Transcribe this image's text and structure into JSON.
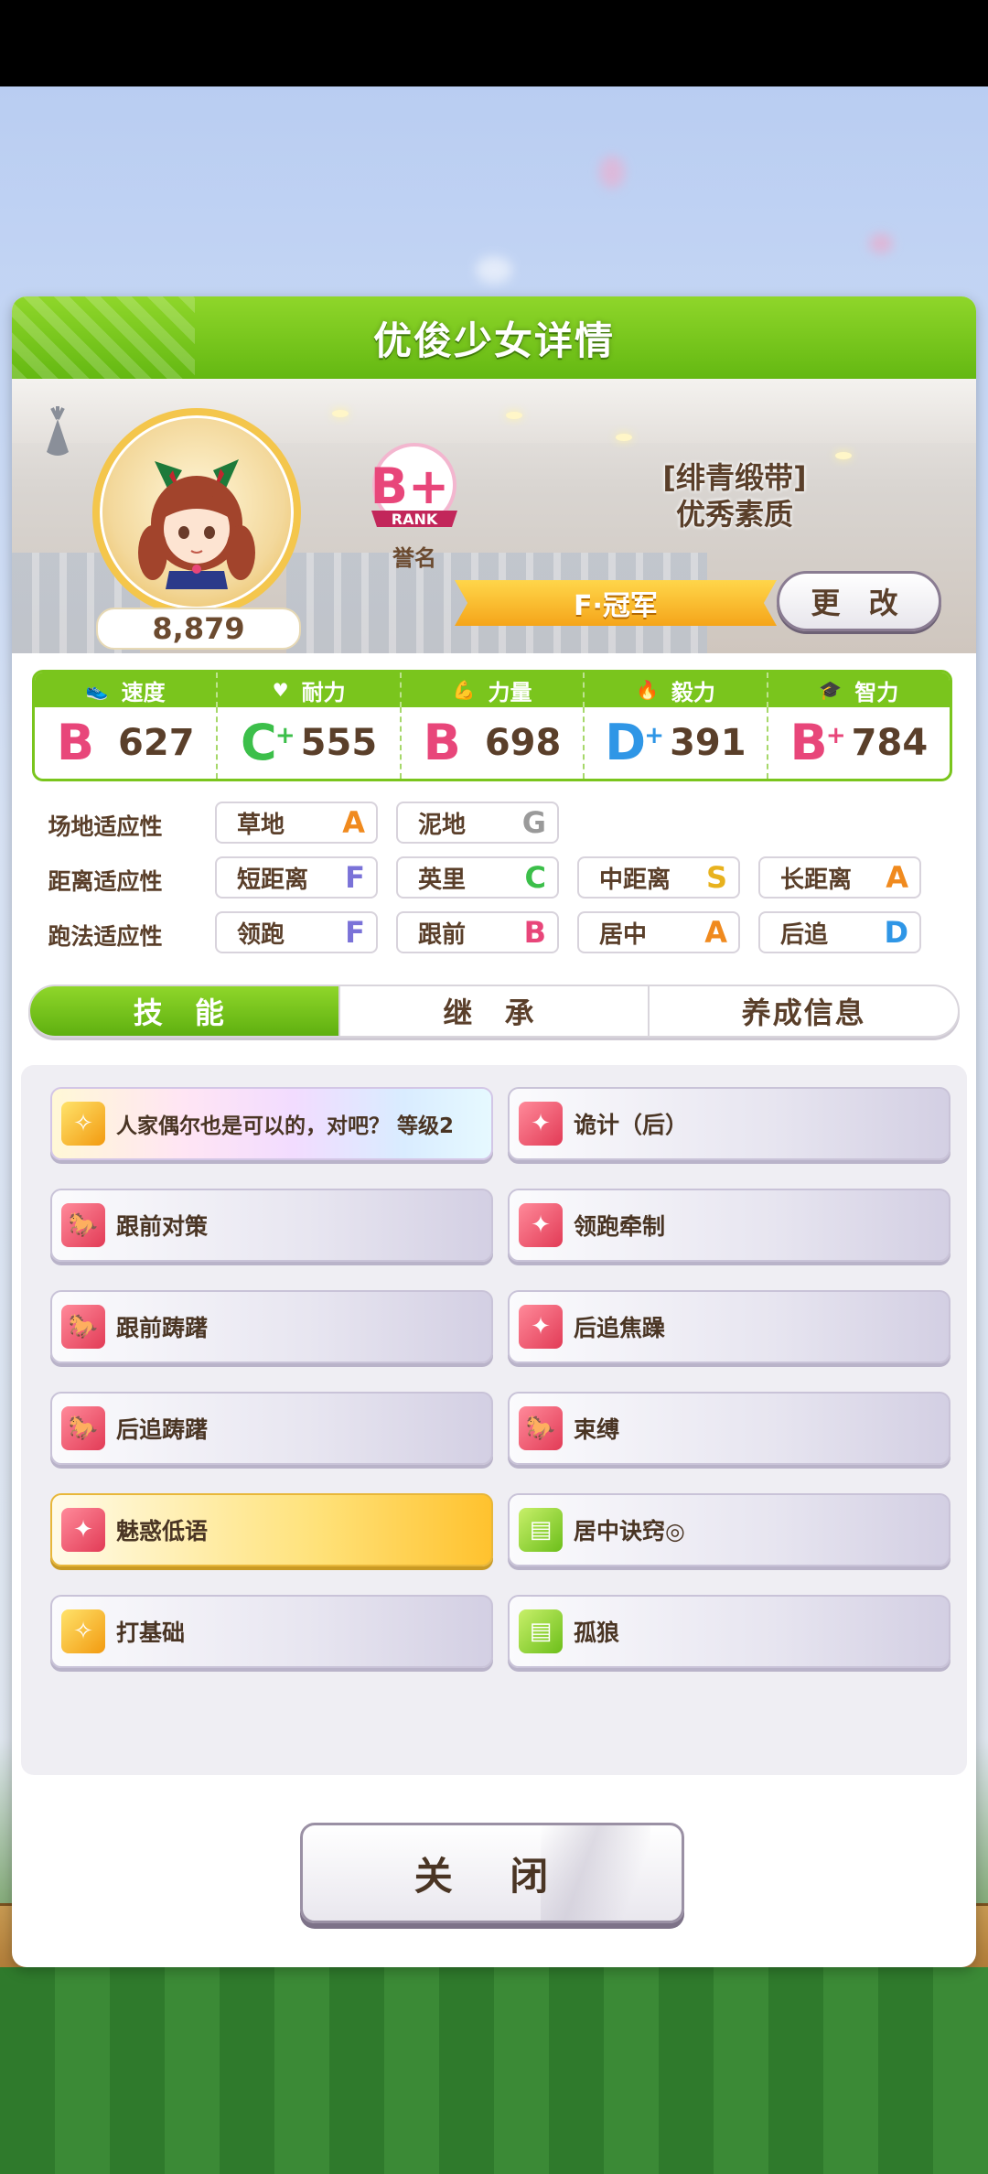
{
  "panel": {
    "title": "优俊少女详情"
  },
  "character": {
    "fans": "8,879",
    "rank_grade": "B+",
    "rank_word": "RANK",
    "rank_label": "誉名",
    "epithet_line1": "[绯青缎带]",
    "epithet_line2": "优秀素质",
    "title": "F·冠军",
    "change_label": "更 改"
  },
  "stats": [
    {
      "name": "速度",
      "icon": "shoe-icon",
      "grade": "B",
      "plus": false,
      "value": "627",
      "color": "#e8467a"
    },
    {
      "name": "耐力",
      "icon": "heart-icon",
      "grade": "C",
      "plus": true,
      "value": "555",
      "color": "#3cbf4a"
    },
    {
      "name": "力量",
      "icon": "muscle-icon",
      "grade": "B",
      "plus": false,
      "value": "698",
      "color": "#e8467a"
    },
    {
      "name": "毅力",
      "icon": "flame-icon",
      "grade": "D",
      "plus": true,
      "value": "391",
      "color": "#2f96e6"
    },
    {
      "name": "智力",
      "icon": "mortarboard-icon",
      "grade": "B",
      "plus": true,
      "value": "784",
      "color": "#e8467a"
    }
  ],
  "aptitudes": [
    {
      "label": "场地适应性",
      "items": [
        {
          "name": "草地",
          "grade": "A",
          "color": "#f08a1e"
        },
        {
          "name": "泥地",
          "grade": "G",
          "color": "#9a9a9a"
        }
      ]
    },
    {
      "label": "距离适应性",
      "items": [
        {
          "name": "短距离",
          "grade": "F",
          "color": "#7a72d8"
        },
        {
          "name": "英里",
          "grade": "C",
          "color": "#3cbf4a"
        },
        {
          "name": "中距离",
          "grade": "S",
          "color": "#e8b21e"
        },
        {
          "name": "长距离",
          "grade": "A",
          "color": "#f08a1e"
        }
      ]
    },
    {
      "label": "跑法适应性",
      "items": [
        {
          "name": "领跑",
          "grade": "F",
          "color": "#7a72d8"
        },
        {
          "name": "跟前",
          "grade": "B",
          "color": "#e8467a"
        },
        {
          "name": "居中",
          "grade": "A",
          "color": "#f08a1e"
        },
        {
          "name": "后追",
          "grade": "D",
          "color": "#2f96e6"
        }
      ]
    }
  ],
  "tabs": [
    "技 能",
    "继 承",
    "养成信息"
  ],
  "skills": [
    {
      "name": "人家偶尔也是可以的，对吧？ 等级2",
      "style": "rainbow",
      "icon": "sparkle-runner-icon",
      "icon_color": "gold"
    },
    {
      "name": "诡计（后）",
      "style": "normal",
      "icon": "sparkle-icon",
      "icon_color": "red"
    },
    {
      "name": "跟前对策",
      "style": "normal",
      "icon": "horse-silhouette-icon",
      "icon_color": "red"
    },
    {
      "name": "领跑牵制",
      "style": "normal",
      "icon": "sparkle-icon",
      "icon_color": "red"
    },
    {
      "name": "跟前踌躇",
      "style": "normal",
      "icon": "horse-silhouette-icon",
      "icon_color": "red"
    },
    {
      "name": "后追焦躁",
      "style": "normal",
      "icon": "sparkle-icon",
      "icon_color": "red"
    },
    {
      "name": "后追踌躇",
      "style": "normal",
      "icon": "horse-silhouette-icon",
      "icon_color": "red"
    },
    {
      "name": "束缚",
      "style": "normal",
      "icon": "horse-silhouette-icon",
      "icon_color": "red"
    },
    {
      "name": "魅惑低语",
      "style": "gold",
      "icon": "sparkle-icon",
      "icon_color": "red"
    },
    {
      "name": "居中诀窍◎",
      "style": "normal",
      "icon": "notebook-icon",
      "icon_color": "green"
    },
    {
      "name": "打基础",
      "style": "normal",
      "icon": "sparkle-runner-icon",
      "icon_color": "gold"
    },
    {
      "name": "孤狼",
      "style": "normal",
      "icon": "notebook-icon",
      "icon_color": "green"
    }
  ],
  "close_label": "关 闭"
}
